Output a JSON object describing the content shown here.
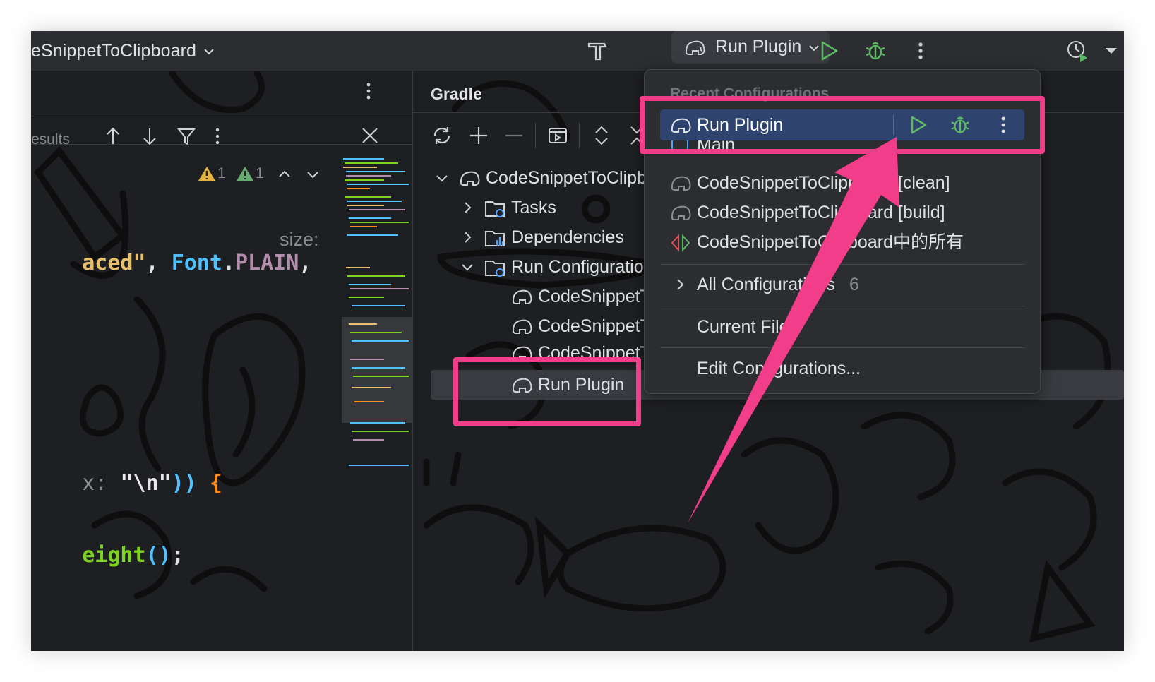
{
  "toolbar": {
    "project_name": "eSnippetToClipboard",
    "run_config_label": "Run Plugin"
  },
  "editor": {
    "find_results_label": "esults",
    "warnings_count_a": "1",
    "warnings_count_b": "1",
    "code_lines": [
      {
        "parts": [
          {
            "text": "aced\"",
            "color": "#e8bf6a"
          },
          {
            "text": ", ",
            "color": "#dfe1e5"
          },
          {
            "text": "Font",
            "color": "#4fc1ff"
          },
          {
            "text": ".",
            "color": "#dfe1e5"
          },
          {
            "text": "PLAIN",
            "color": "#b48ead"
          },
          {
            "text": ",",
            "color": "#dfe1e5"
          }
        ],
        "hint": "size:"
      },
      {
        "parts": [
          {
            "text": "x: ",
            "color": "#8a8c90"
          },
          {
            "text": "\"\\n\"",
            "color": "#e8e8e8"
          },
          {
            "text": "))",
            "color": "#4fc1ff"
          },
          {
            "text": " {",
            "color": "#ff8c1a"
          }
        ]
      },
      {
        "parts": [
          {
            "text": "eight",
            "color": "#7ed321"
          },
          {
            "text": "()",
            "color": "#4fc1ff"
          },
          {
            "text": ";",
            "color": "#dfe1e5"
          }
        ]
      }
    ]
  },
  "gradle": {
    "title": "Gradle",
    "tree": [
      {
        "label": "CodeSnippetToClipbo",
        "icon": "elephant-icon",
        "expanded": true
      },
      {
        "label": "Tasks",
        "icon": "folder-gear-icon",
        "expanded": false
      },
      {
        "label": "Dependencies",
        "icon": "folder-chart-icon",
        "expanded": false
      },
      {
        "label": "Run Configuration",
        "icon": "folder-gear-icon",
        "expanded": true
      },
      {
        "label": "CodeSnippetTo",
        "icon": "elephant-icon"
      },
      {
        "label": "CodeSnippetTo",
        "icon": "elephant-icon"
      },
      {
        "label": "CodeSnippetTo",
        "icon": "elephant-icon"
      },
      {
        "label": "Run Plugin",
        "icon": "elephant-icon",
        "selected": true
      }
    ]
  },
  "popup": {
    "header": "Recent Configurations",
    "selected_item": "Run Plugin",
    "items": [
      {
        "label": "Main",
        "icon": "app-icon"
      },
      {
        "label": "CodeSnippetToClipboard [clean]",
        "icon": "elephant-icon"
      },
      {
        "label": "CodeSnippetToClipboard [build]",
        "icon": "elephant-icon"
      },
      {
        "label": "CodeSnippetToClipboard中的所有",
        "icon": "compound-icon"
      }
    ],
    "all_configurations": "All Configurations",
    "all_configurations_count": "6",
    "current_file": "Current File",
    "edit_configurations": "Edit Configurations..."
  },
  "colors": {
    "highlight": "#f23d8a",
    "run_green": "#5fb865",
    "selection_blue": "#2e436e"
  }
}
